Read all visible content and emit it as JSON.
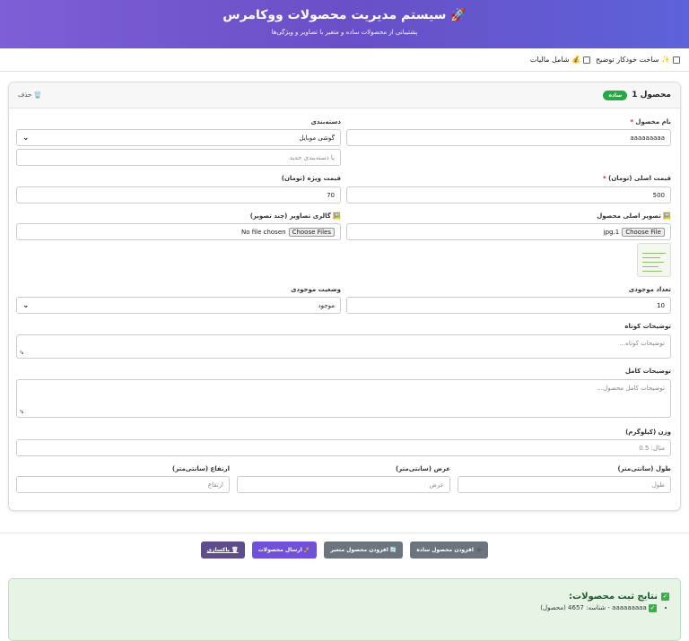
{
  "header": {
    "title": "🚀 سیستم مدیریت محصولات ووکامرس",
    "subtitle": "پشتیبانی از محصولات ساده و متغیر با تصاویر و ویژگی‌ها"
  },
  "options": {
    "auto_description": "✨ ساخت خودکار توضیح",
    "include_tax": "💰 شامل مالیات"
  },
  "product": {
    "title": "محصول 1",
    "type_badge": "ساده",
    "delete_label": "🗑️ حذف",
    "name_label": "نام محصول",
    "name_value": "aaaaaaaaa",
    "category_label": "دسته‌بندی",
    "category_value": "گوشی موبایل",
    "new_category_placeholder": "یا دسته‌بندی جدید",
    "price_label": "قیمت اصلی (تومان)",
    "price_value": "500",
    "sale_price_label": "قیمت ویژه (تومان)",
    "sale_price_value": "70",
    "main_image_label": "🖼️ تصویر اصلی محصول",
    "main_image_file": "1.jpg",
    "gallery_label": "🖼️ گالری تصاویر (چند تصویر)",
    "gallery_file": "No file chosen",
    "choose_file": "Choose File",
    "choose_files": "Choose Files",
    "stock_qty_label": "تعداد موجودی",
    "stock_qty_value": "10",
    "stock_status_label": "وضعیت موجودی",
    "stock_status_value": "موجود",
    "short_desc_label": "توضیحات کوتاه",
    "short_desc_placeholder": "توضیحات کوتاه...",
    "full_desc_label": "توضیحات کامل",
    "full_desc_placeholder": "توضیحات کامل محصول...",
    "weight_label": "وزن (کیلوگرم)",
    "weight_placeholder": "مثال: 0.5",
    "length_label": "طول (سانتی‌متر)",
    "length_placeholder": "طول",
    "width_label": "عرض (سانتی‌متر)",
    "width_placeholder": "عرض",
    "height_label": "ارتفاع (سانتی‌متر)",
    "height_placeholder": "ارتفاع"
  },
  "actions": {
    "add_simple": "➕ افزودن محصول ساده",
    "add_variable": "🔄 افزودن محصول متغیر",
    "submit": "🚀 ارسال محصولات",
    "reset": "🗑 پاکسازی"
  },
  "results": {
    "title": "نتایج ثبت محصولات:",
    "items": [
      "aaaaaaaaa - شناسه: 4657 (محصول)"
    ]
  },
  "colors": {
    "header_gradient_start": "#7d5fd6",
    "header_gradient_end": "#5d62d8",
    "badge_green": "#28a745",
    "results_bg": "#e6f4e6"
  }
}
